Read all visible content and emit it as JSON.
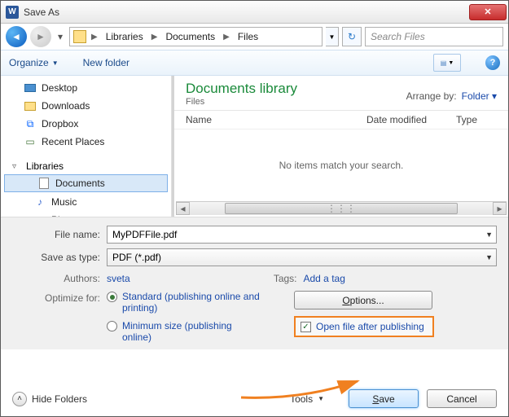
{
  "title": "Save As",
  "breadcrumb": {
    "root": "Libraries",
    "mid": "Documents",
    "leaf": "Files"
  },
  "search_placeholder": "Search Files",
  "toolbar": {
    "organize": "Organize",
    "newfolder": "New folder"
  },
  "sidebar": {
    "desktop": "Desktop",
    "downloads": "Downloads",
    "dropbox": "Dropbox",
    "recent": "Recent Places",
    "libraries": "Libraries",
    "documents": "Documents",
    "music": "Music",
    "pictures": "Pictures"
  },
  "main": {
    "heading": "Documents library",
    "sub": "Files",
    "arrange_lbl": "Arrange by:",
    "arrange_val": "Folder",
    "col_name": "Name",
    "col_date": "Date modified",
    "col_type": "Type",
    "empty": "No items match your search."
  },
  "form": {
    "filename_lbl": "File name:",
    "filename_val": "MyPDFFile.pdf",
    "type_lbl": "Save as type:",
    "type_val": "PDF (*.pdf)",
    "authors_lbl": "Authors:",
    "authors_val": "sveta",
    "tags_lbl": "Tags:",
    "tags_val": "Add a tag",
    "optimize_lbl": "Optimize for:",
    "opt_standard": "Standard (publishing online and printing)",
    "opt_min": "Minimum size (publishing online)",
    "options_btn": "Options...",
    "open_after": "Open file after publishing"
  },
  "footer": {
    "hide": "Hide Folders",
    "tools": "Tools",
    "save": "Save",
    "cancel": "Cancel"
  }
}
